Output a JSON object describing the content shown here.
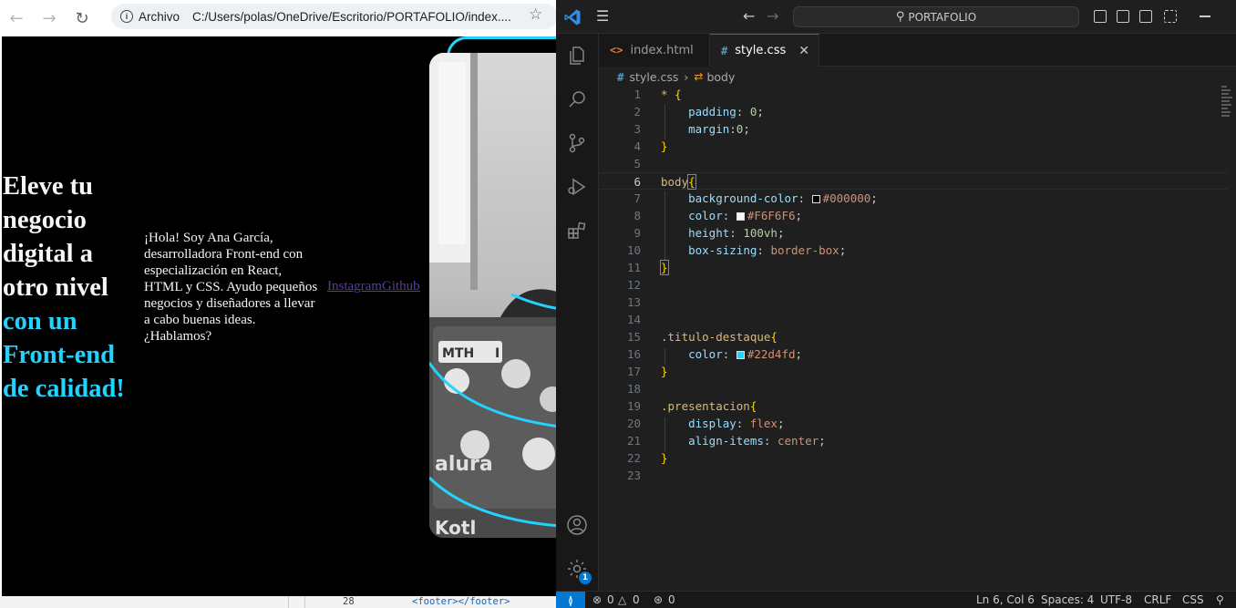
{
  "browser": {
    "address_scheme": "Archivo",
    "address_path": "C:/Users/polas/OneDrive/Escritorio/PORTAFOLIO/index....",
    "page": {
      "title_lines": [
        "Eleve tu",
        "negocio",
        "digital a",
        "otro nivel"
      ],
      "title_accent_lines": [
        "con un",
        "Front-end",
        "de calidad!"
      ],
      "description": "¡Hola! Soy Ana García, desarrolladora Front-end con especialización en React, HTML y CSS. Ayudo pequeños negocios y diseñadores a llevar a cabo buenas ideas. ¿Hablamos?",
      "link_instagram": "Instagram",
      "link_github": "Github",
      "photo_stickers": [
        "MTH",
        "I",
        "alura",
        "Kotl"
      ]
    },
    "devtools_line_number": "28",
    "devtools_code": "<footer></footer>"
  },
  "vscode": {
    "command_center": "PORTAFOLIO",
    "tabs": [
      {
        "label": "index.html",
        "icon": "<>"
      },
      {
        "label": "style.css",
        "icon": "#"
      }
    ],
    "breadcrumb": {
      "file": "style.css",
      "symbol": "body"
    },
    "line_numbers": [
      "1",
      "2",
      "3",
      "4",
      "5",
      "6",
      "7",
      "8",
      "9",
      "10",
      "11",
      "12",
      "13",
      "14",
      "15",
      "16",
      "17",
      "18",
      "19",
      "20",
      "21",
      "22",
      "23"
    ],
    "code": {
      "l1_sel": "*",
      "l1_brace": "{",
      "l2_prop": "padding",
      "l2_val": "0",
      "l3_prop": "margin",
      "l3_val": "0",
      "l4_brace": "}",
      "l6_sel": "body",
      "l6_brace": "{",
      "l7_prop": "background-color",
      "l7_val": "#000000",
      "l8_prop": "color",
      "l8_val": "#F6F6F6",
      "l9_prop": "height",
      "l9_val": "100vh",
      "l10_prop": "box-sizing",
      "l10_val": "border-box",
      "l11_brace": "}",
      "l15_sel": ".titulo-destaque",
      "l15_brace": "{",
      "l16_prop": "color",
      "l16_val": "#22d4fd",
      "l17_brace": "}",
      "l19_sel": ".presentacion",
      "l19_brace": "{",
      "l20_prop": "display",
      "l20_val": "flex",
      "l21_prop": "align-items",
      "l21_val": "center",
      "l22_brace": "}"
    },
    "status": {
      "errors": "0",
      "warnings": "0",
      "ports": "0",
      "cursor": "Ln 6, Col 6",
      "spaces": "Spaces: 4",
      "encoding": "UTF-8",
      "eol": "CRLF",
      "language": "CSS"
    },
    "accounts_badge": "1"
  },
  "colors": {
    "accent": "#22d4fd",
    "text": "#F6F6F6",
    "page_bg": "#000000",
    "vscode_blue": "#0078d4"
  }
}
